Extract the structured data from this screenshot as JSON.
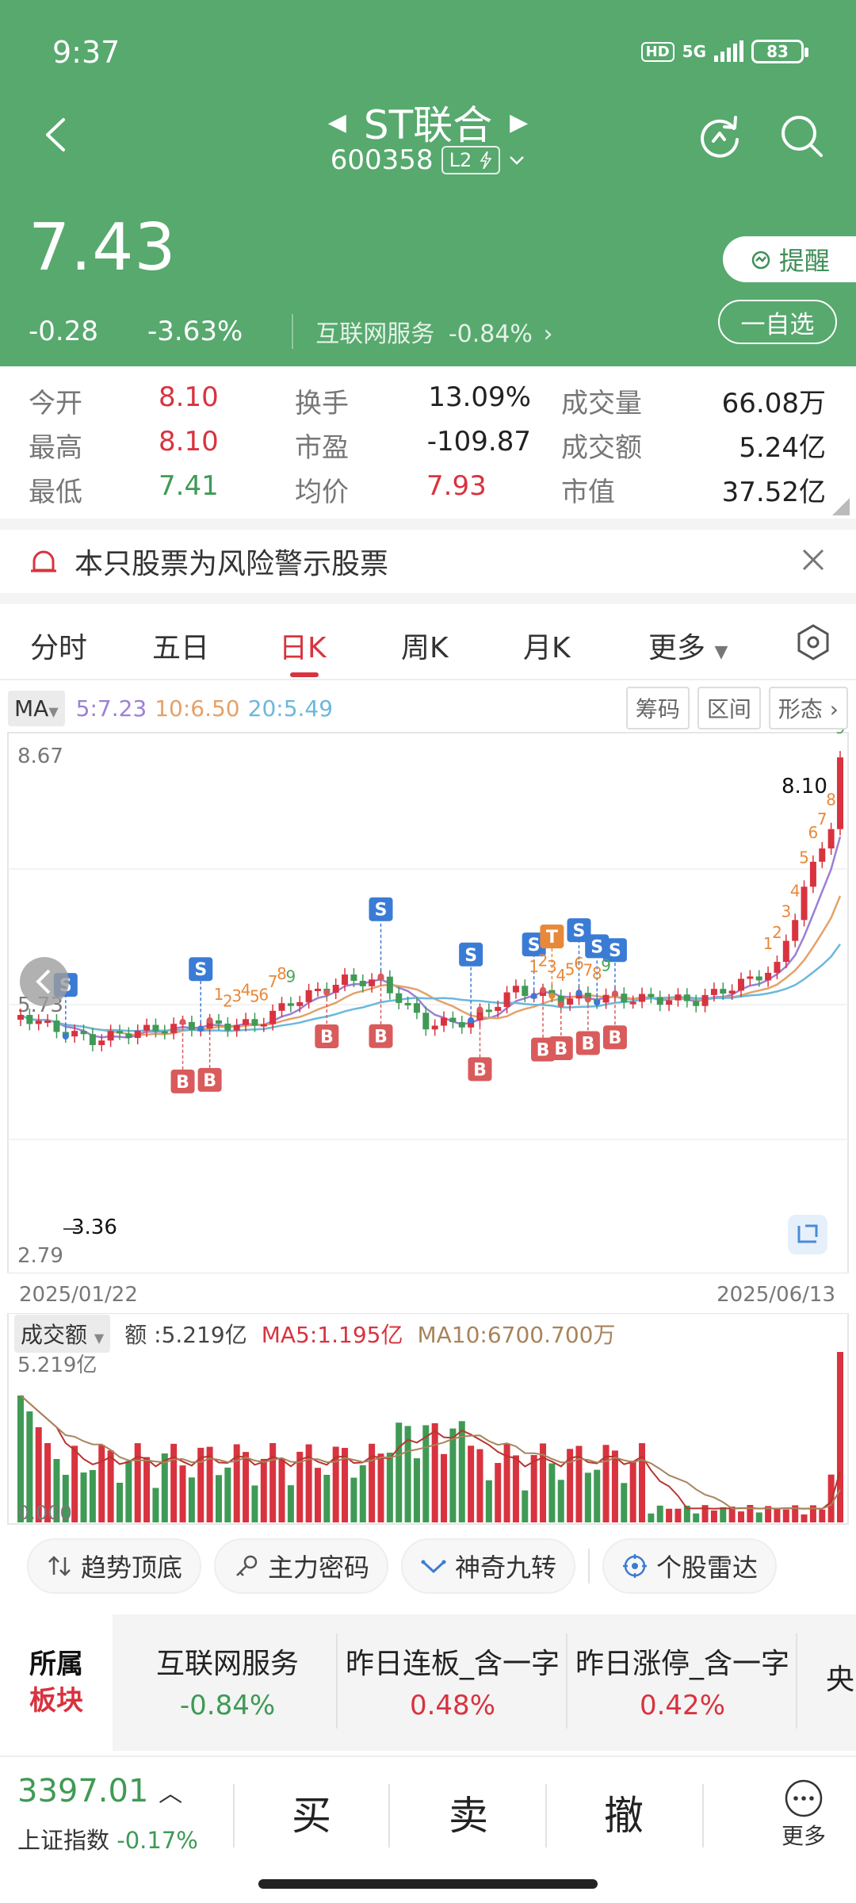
{
  "status_bar": {
    "time": "9:37",
    "hd": "HD",
    "net": "5G",
    "battery": "83"
  },
  "header": {
    "title": "ST联合",
    "code": "600358",
    "level": "L2",
    "price": "7.43",
    "change": "-0.28",
    "change_pct": "-3.63%",
    "sector": "互联网服务",
    "sector_pct": "-0.84%",
    "remind_label": "提醒",
    "watch_label": "一自选"
  },
  "stats": {
    "rows": [
      [
        {
          "label": "今开",
          "value": "8.10",
          "color": "red"
        },
        {
          "label": "换手",
          "value": "13.09%",
          "color": "dark"
        },
        {
          "label": "成交量",
          "value": "66.08万",
          "color": "dark"
        }
      ],
      [
        {
          "label": "最高",
          "value": "8.10",
          "color": "red"
        },
        {
          "label": "市盈",
          "value": "-109.87",
          "color": "dark"
        },
        {
          "label": "成交额",
          "value": "5.24亿",
          "color": "dark"
        }
      ],
      [
        {
          "label": "最低",
          "value": "7.41",
          "color": "green"
        },
        {
          "label": "均价",
          "value": "7.93",
          "color": "red"
        },
        {
          "label": "市值",
          "value": "37.52亿",
          "color": "dark"
        }
      ]
    ]
  },
  "warning_text": "本只股票为风险警示股票",
  "tabs": [
    "分时",
    "五日",
    "日K",
    "周K",
    "月K",
    "更多"
  ],
  "active_tab": "日K",
  "ma": {
    "selector": "MA",
    "ma5": "5:7.23",
    "ma10": "10:6.50",
    "ma20": "20:5.49",
    "buttons": [
      "筹码",
      "区间",
      "形态"
    ]
  },
  "colors": {
    "up": "#d8333f",
    "down": "#3f9a55",
    "header_green": "#57a96e",
    "ma5": "#9b80d6",
    "ma10": "#e3a26a",
    "ma20": "#6bb8dc"
  },
  "kline_chart": {
    "chart_data": {
      "type": "candlestick",
      "y_max": "8.67",
      "y_mid": "5.73",
      "y_min": "2.79",
      "ylim": [
        2.79,
        8.67
      ],
      "high_label": "8.10",
      "low_label": "3.36",
      "start_date": "2025/01/22",
      "end_date": "2025/06/13",
      "signal_s": "S",
      "signal_b": "B",
      "signal_t": "T",
      "nine_turn_labels": [
        "1",
        "2",
        "3",
        "4",
        "5",
        "6",
        "7",
        "8",
        "9"
      ]
    }
  },
  "volume": {
    "selector": "成交额",
    "amount": "额 :5.219亿",
    "ma5": "MA5:1.195亿",
    "ma10": "MA10:6700.700万",
    "ymax": "5.219亿",
    "ymin": "0.000"
  },
  "tools": [
    "趋势顶底",
    "主力密码",
    "神奇九转",
    "个股雷达"
  ],
  "sector_strip": {
    "label_top": "所属",
    "label_bottom": "板块",
    "items": [
      {
        "name": "互联网服务",
        "pct": "-0.84%",
        "color": "green"
      },
      {
        "name": "昨日连板_含一字",
        "pct": "0.48%",
        "color": "red"
      },
      {
        "name": "昨日涨停_含一字",
        "pct": "0.42%",
        "color": "red"
      },
      {
        "name": "央",
        "pct": "",
        "color": "red"
      }
    ]
  },
  "bottom_bar": {
    "index_value": "3397.01",
    "index_name": "上证指数",
    "index_pct": "-0.17%",
    "buy": "买",
    "sell": "卖",
    "cancel": "撤",
    "more": "更多"
  }
}
